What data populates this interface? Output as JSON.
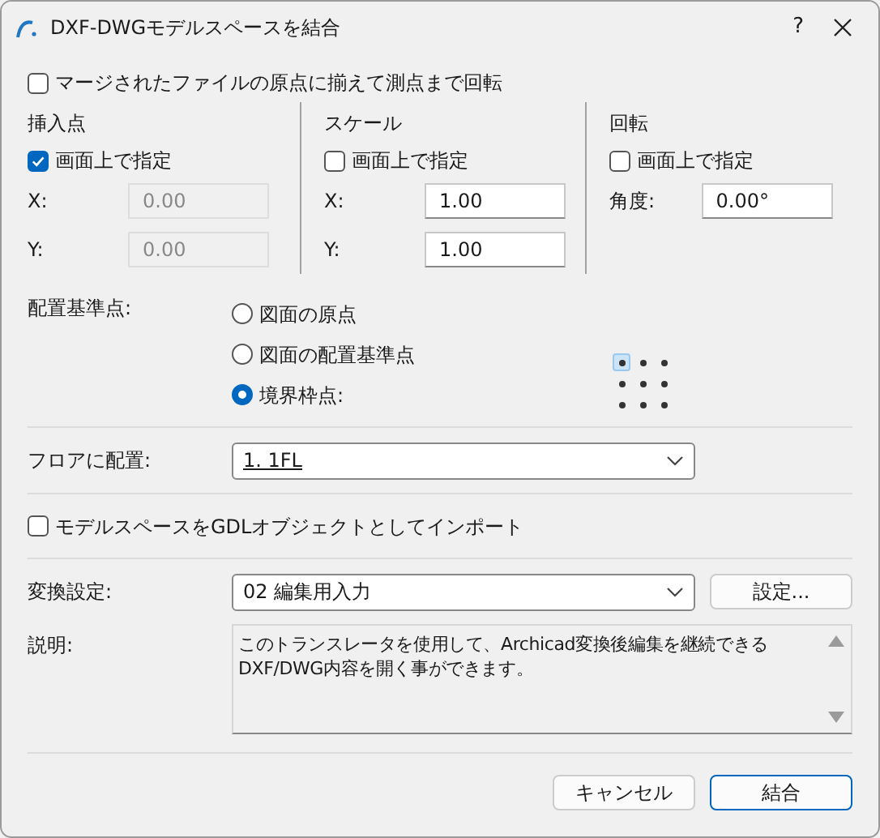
{
  "window": {
    "title": "DXF-DWGモデルスペースを結合",
    "help": "?"
  },
  "align_option": {
    "label": "マージされたファイルの原点に揃えて測点まで回転",
    "checked": false
  },
  "groups": [
    {
      "title": "挿入点",
      "on_screen": {
        "label": "画面上で指定",
        "checked": true
      },
      "fields": [
        {
          "label": "X:",
          "value": "0.00",
          "disabled": true
        },
        {
          "label": "Y:",
          "value": "0.00",
          "disabled": true
        }
      ]
    },
    {
      "title": "スケール",
      "on_screen": {
        "label": "画面上で指定",
        "checked": false
      },
      "fields": [
        {
          "label": "X:",
          "value": "1.00",
          "disabled": false
        },
        {
          "label": "Y:",
          "value": "1.00",
          "disabled": false
        }
      ]
    },
    {
      "title": "回転",
      "on_screen": {
        "label": "画面上で指定",
        "checked": false
      },
      "fields": [
        {
          "label": "角度:",
          "value": "0.00°",
          "disabled": false
        }
      ]
    }
  ],
  "anchor": {
    "label": "配置基準点:",
    "options": [
      {
        "label": "図面の原点",
        "selected": false
      },
      {
        "label": "図面の配置基準点",
        "selected": false
      },
      {
        "label": "境界枠点:",
        "selected": true
      }
    ],
    "points": [
      {
        "selected": true
      },
      {
        "selected": false
      },
      {
        "selected": false
      },
      {
        "selected": false
      },
      {
        "selected": false
      },
      {
        "selected": false
      },
      {
        "selected": false
      },
      {
        "selected": false
      },
      {
        "selected": false
      }
    ]
  },
  "floor": {
    "label": "フロアに配置:",
    "value": "1. 1FL"
  },
  "gdl_option": {
    "label": "モデルスペースをGDLオブジェクトとしてインポート",
    "checked": false
  },
  "translator": {
    "label": "変換設定:",
    "value": "02 編集用入力",
    "button": "設定..."
  },
  "description": {
    "label": "説明:",
    "text": "このトランスレータを使用して、Archicad変換後編集を継続できる\nDXF/DWG内容を開く事ができます。"
  },
  "buttons": [
    {
      "label": "キャンセル",
      "default": false
    },
    {
      "label": "結合",
      "default": true
    }
  ]
}
